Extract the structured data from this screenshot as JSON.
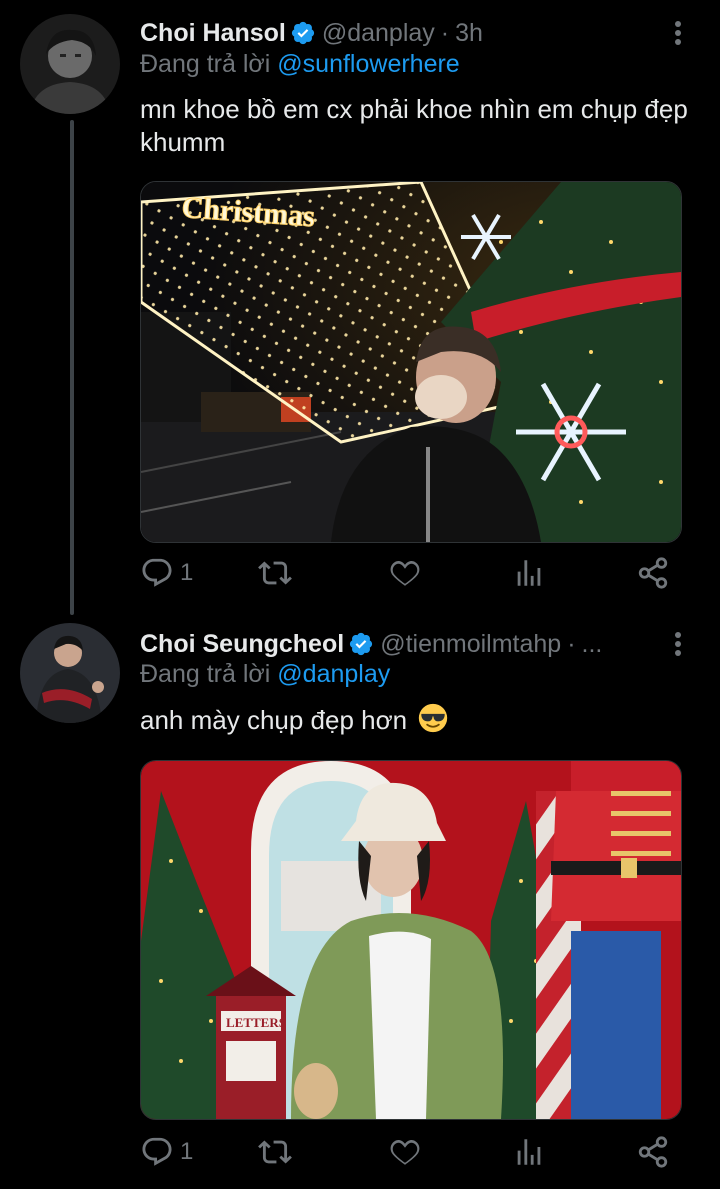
{
  "thread": {
    "tweets": [
      {
        "author": {
          "name": "Choi Hansol",
          "handle": "@danplay",
          "verified": true,
          "avatar_icon": "profile-photo"
        },
        "separator": "·",
        "time": "3h",
        "replying": {
          "prefix": "Đang trả lời",
          "mention": "@sunflowerhere"
        },
        "text": "mn khoe bồ em cx phải khoe nhìn em chụp đẹp khumm",
        "media": {
          "description_icon": "photo-christmas-lights",
          "sign_text": "Christmas"
        },
        "actions": {
          "reply_count": "1",
          "retweet_count": "",
          "like_count": "",
          "icons": [
            "reply-icon",
            "retweet-icon",
            "like-icon",
            "analytics-icon",
            "share-icon"
          ]
        }
      },
      {
        "author": {
          "name": "Choi Seungcheol",
          "handle": "@tienmoilmtahp",
          "verified": true,
          "avatar_icon": "profile-photo"
        },
        "separator": "·",
        "time": "...",
        "replying": {
          "prefix": "Đang trả lời",
          "mention": "@danplay"
        },
        "text": "anh mày chụp đẹp hơn",
        "emoji": "smiling-face-with-sunglasses",
        "media": {
          "description_icon": "photo-christmas-red-wall",
          "sign_text": "LETTERS"
        },
        "actions": {
          "reply_count": "1",
          "retweet_count": "",
          "like_count": "",
          "icons": [
            "reply-icon",
            "retweet-icon",
            "like-icon",
            "analytics-icon",
            "share-icon"
          ]
        }
      }
    ]
  },
  "colors": {
    "background": "#000000",
    "primary_text": "#e7e9ea",
    "secondary_text": "#71767b",
    "accent": "#1d9bf0",
    "thread_line": "#3d4348"
  }
}
